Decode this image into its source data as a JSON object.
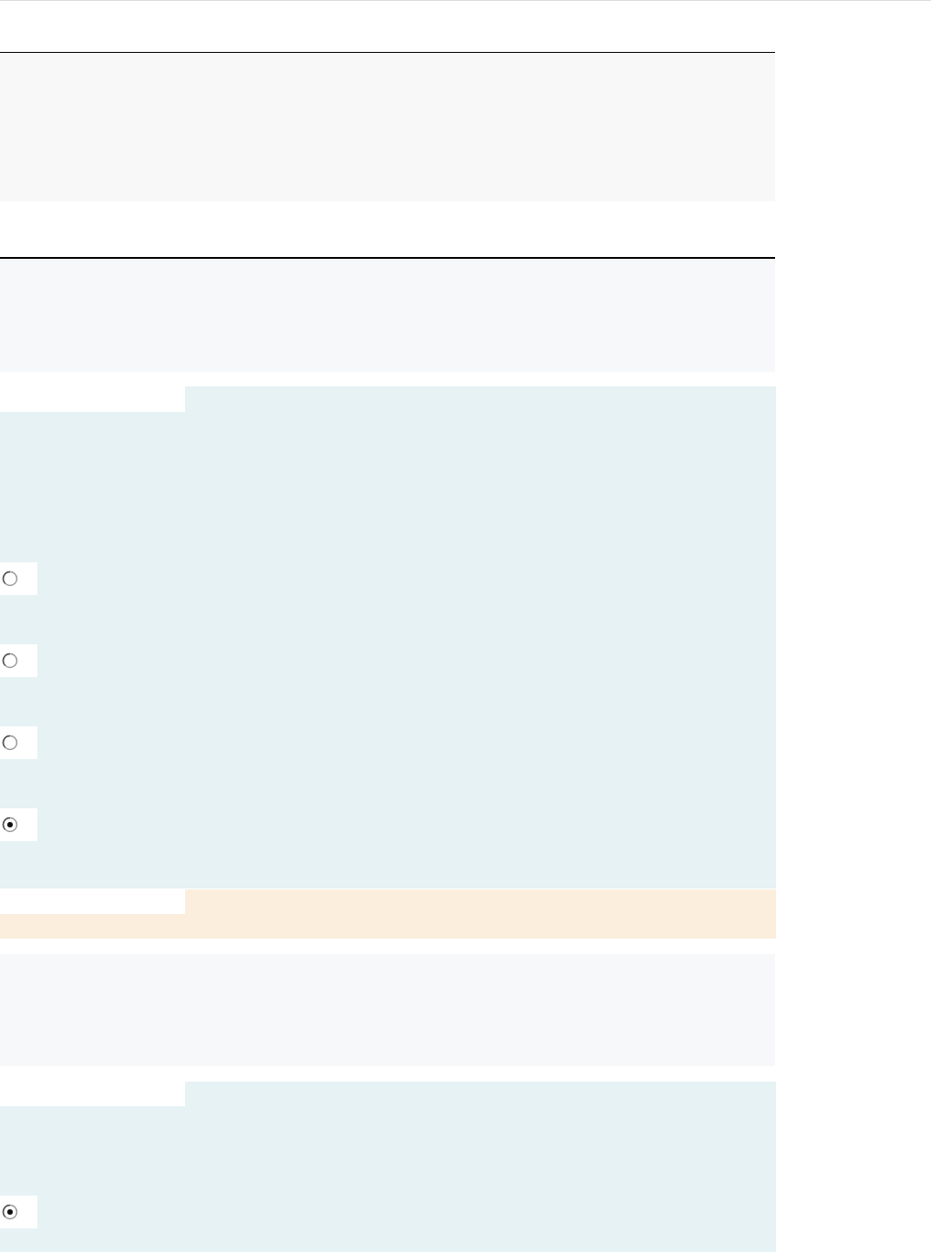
{
  "blocks": [
    {
      "kind": "section"
    },
    {
      "kind": "section"
    },
    {
      "kind": "question",
      "options": [
        {
          "selected": false
        },
        {
          "selected": false
        },
        {
          "selected": false
        },
        {
          "selected": true
        }
      ]
    },
    {
      "kind": "notice"
    },
    {
      "kind": "panel"
    },
    {
      "kind": "question",
      "options": [
        {
          "selected": true
        }
      ]
    }
  ]
}
